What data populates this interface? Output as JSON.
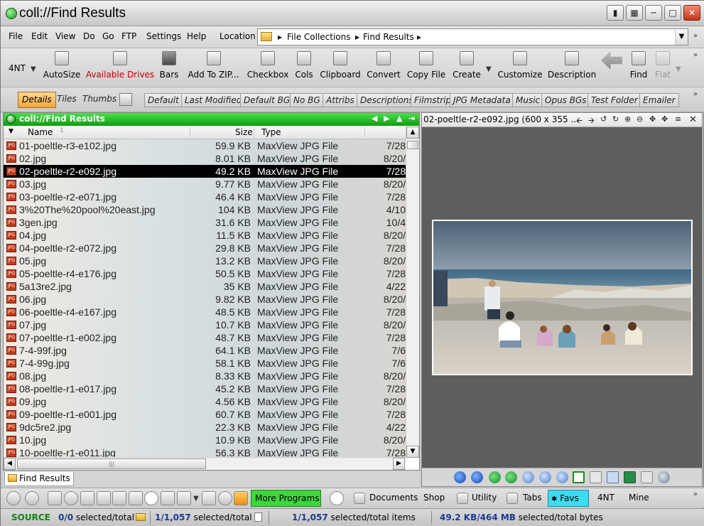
{
  "window": {
    "title": "coll://Find Results"
  },
  "menu": [
    "File",
    "Edit",
    "View",
    "Do",
    "Go",
    "FTP",
    "Settings",
    "Help"
  ],
  "location": {
    "label": "Location",
    "crumbs": [
      "File Collections",
      "Find Results"
    ]
  },
  "toolbar": {
    "left_label": "4NT",
    "buttons": [
      "AutoSize",
      "Available Drives",
      "Bars",
      "Add To ZIP...",
      "Checkbox",
      "Cols",
      "Clipboard",
      "Convert",
      "Copy File",
      "Create",
      "Customize",
      "Description",
      "Find",
      "Flat"
    ]
  },
  "viewbar": {
    "views": [
      "Details",
      "Tiles",
      "Thumbs"
    ],
    "selected_view": "Details",
    "layouts": [
      "Default",
      "Last Modified",
      "Default BG",
      "No BG",
      "Attribs",
      "Descriptions",
      "Filmstrip",
      "JPG Metadata",
      "Music",
      "Opus BGs",
      "Test Folder",
      "Emailer"
    ]
  },
  "lister": {
    "title": "coll://Find Results",
    "columns": {
      "name": "Name",
      "name_sort": "1",
      "size": "Size",
      "type": "Type"
    },
    "files": [
      {
        "name": "01-poeltle-r3-e102.jpg",
        "size": "59.9 KB",
        "type": "MaxView JPG File",
        "date": "7/28"
      },
      {
        "name": "02.jpg",
        "size": "8.01 KB",
        "type": "MaxView JPG File",
        "date": "8/20/"
      },
      {
        "name": "02-poeltle-r2-e092.jpg",
        "size": "49.2 KB",
        "type": "MaxView JPG File",
        "date": "7/28",
        "selected": true
      },
      {
        "name": "03.jpg",
        "size": "9.77 KB",
        "type": "MaxView JPG File",
        "date": "8/20/"
      },
      {
        "name": "03-poeltle-r2-e071.jpg",
        "size": "46.4 KB",
        "type": "MaxView JPG File",
        "date": "7/28"
      },
      {
        "name": "3%20The%20pool%20east.jpg",
        "size": "104 KB",
        "type": "MaxView JPG File",
        "date": "4/10"
      },
      {
        "name": "3gen.jpg",
        "size": "31.6 KB",
        "type": "MaxView JPG File",
        "date": "10/4"
      },
      {
        "name": "04.jpg",
        "size": "11.5 KB",
        "type": "MaxView JPG File",
        "date": "8/20/"
      },
      {
        "name": "04-poeltle-r2-e072.jpg",
        "size": "29.8 KB",
        "type": "MaxView JPG File",
        "date": "7/28"
      },
      {
        "name": "05.jpg",
        "size": "13.2 KB",
        "type": "MaxView JPG File",
        "date": "8/20/"
      },
      {
        "name": "05-poeltle-r4-e176.jpg",
        "size": "50.5 KB",
        "type": "MaxView JPG File",
        "date": "7/28"
      },
      {
        "name": "5a13re2.jpg",
        "size": "35 KB",
        "type": "MaxView JPG File",
        "date": "4/22"
      },
      {
        "name": "06.jpg",
        "size": "9.82 KB",
        "type": "MaxView JPG File",
        "date": "8/20/"
      },
      {
        "name": "06-poeltle-r4-e167.jpg",
        "size": "48.5 KB",
        "type": "MaxView JPG File",
        "date": "7/28"
      },
      {
        "name": "07.jpg",
        "size": "10.7 KB",
        "type": "MaxView JPG File",
        "date": "8/20/"
      },
      {
        "name": "07-poeltle-r1-e002.jpg",
        "size": "48.7 KB",
        "type": "MaxView JPG File",
        "date": "7/28"
      },
      {
        "name": "7-4-99f.jpg",
        "size": "64.1 KB",
        "type": "MaxView JPG File",
        "date": "7/6"
      },
      {
        "name": "7-4-99g.jpg",
        "size": "58.1 KB",
        "type": "MaxView JPG File",
        "date": "7/6"
      },
      {
        "name": "08.jpg",
        "size": "8.33 KB",
        "type": "MaxView JPG File",
        "date": "8/20/"
      },
      {
        "name": "08-poeltle-r1-e017.jpg",
        "size": "45.2 KB",
        "type": "MaxView JPG File",
        "date": "7/28"
      },
      {
        "name": "09.jpg",
        "size": "4.56 KB",
        "type": "MaxView JPG File",
        "date": "8/20/"
      },
      {
        "name": "09-poeltle-r1-e001.jpg",
        "size": "60.7 KB",
        "type": "MaxView JPG File",
        "date": "7/28"
      },
      {
        "name": "9dc5re2.jpg",
        "size": "22.3 KB",
        "type": "MaxView JPG File",
        "date": "4/22"
      },
      {
        "name": "10.jpg",
        "size": "10.9 KB",
        "type": "MaxView JPG File",
        "date": "8/20/"
      },
      {
        "name": "10-poeltle-r1-e011.jpg",
        "size": "56.3 KB",
        "type": "MaxView JPG File",
        "date": "7/28"
      }
    ],
    "tab": "Find Results"
  },
  "viewer": {
    "title": "02-poeltle-r2-e092.jpg (600 x 355 ..."
  },
  "programs": {
    "more": "More Programs",
    "documents": "Documents",
    "shop": "Shop",
    "utility": "Utility",
    "tabs": "Tabs",
    "favs": "Favs",
    "fournt": "4NT",
    "mine": "Mine"
  },
  "status": {
    "source": "SOURCE",
    "dirs_count": "0/0",
    "dirs_label": "selected/total",
    "files_count": "1/1,057",
    "files_label": "selected/total",
    "items_count": "1/1,057",
    "items_label": "selected/total items",
    "bytes_count": "49.2 KB/464 MB",
    "bytes_label": "selected/total bytes"
  },
  "colors": {
    "accent_green": "#1aa01a",
    "selection": "#000000",
    "favs": "#3edcf0",
    "more_programs": "#3fd63f"
  }
}
